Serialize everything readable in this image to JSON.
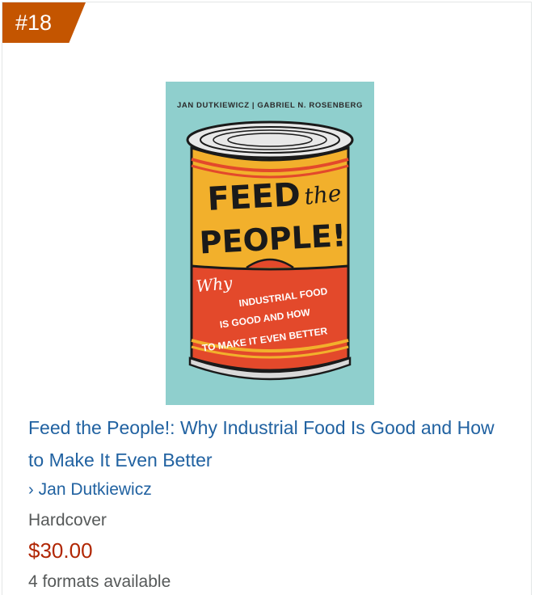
{
  "product": {
    "rank": "#18",
    "title": "Feed the People!: Why Industrial Food Is Good and How to Make It Even Better",
    "author_chevron": "›",
    "author": "Jan Dutkiewicz",
    "format": "Hardcover",
    "price": "$30.00",
    "formats_available": "4 formats available"
  },
  "cover": {
    "authors_line": "JAN DUTKIEWICZ | GABRIEL N. ROSENBERG",
    "title_feed": "FEED",
    "title_the": "the",
    "title_people": "PEOPLE!",
    "sub_why": "Why",
    "sub_line1": "INDUSTRIAL FOOD",
    "sub_line2": "IS GOOD AND HOW",
    "sub_line3": "TO MAKE IT EVEN BETTER"
  },
  "colors": {
    "badge": "#c45500",
    "link": "#2162a1",
    "price": "#b12704",
    "secondary_text": "#565959",
    "cover_bg": "#8fcfcd",
    "can_yellow": "#f2b02c",
    "can_red": "#e3492b"
  }
}
